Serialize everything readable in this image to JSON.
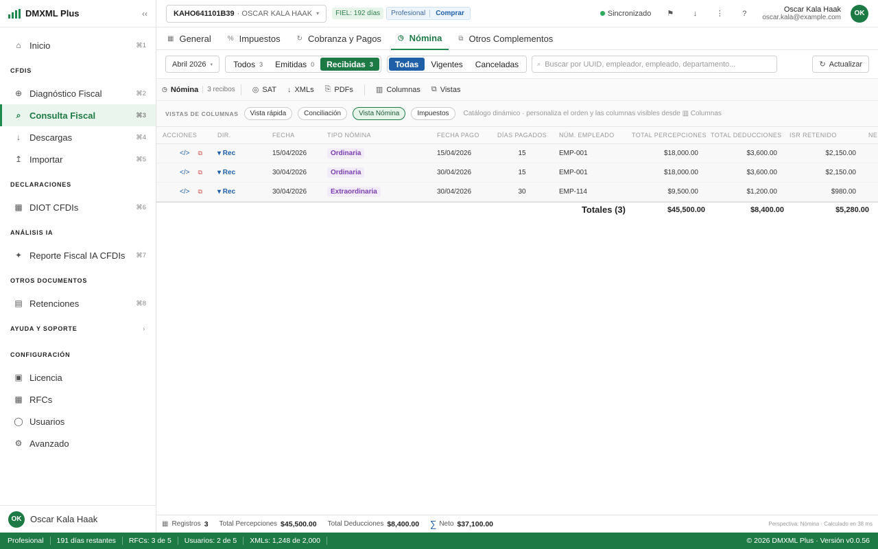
{
  "sidebar": {
    "brand": "DMXML Plus",
    "collapse_icon": "‹‹",
    "nav": [
      {
        "type": "item",
        "icon": "⌂",
        "icon_name": "home-icon",
        "label": "Inicio",
        "kbd": "⌘1"
      },
      {
        "type": "section",
        "label": "CFDIS"
      },
      {
        "type": "item",
        "icon": "⊕",
        "icon_name": "diagnostic-icon",
        "label": "Diagnóstico Fiscal",
        "kbd": "⌘2"
      },
      {
        "type": "item",
        "icon": "⌕",
        "icon_name": "search-icon",
        "label": "Consulta Fiscal",
        "kbd": "⌘3",
        "active": true
      },
      {
        "type": "item",
        "icon": "↓",
        "icon_name": "download-icon",
        "label": "Descargas",
        "kbd": "⌘4"
      },
      {
        "type": "item",
        "icon": "↥",
        "icon_name": "import-icon",
        "label": "Importar",
        "kbd": "⌘5"
      },
      {
        "type": "section",
        "label": "DECLARACIONES"
      },
      {
        "type": "item",
        "icon": "▦",
        "icon_name": "table-icon",
        "label": "DIOT CFDIs",
        "kbd": "⌘6"
      },
      {
        "type": "section",
        "label": "ANÁLISIS IA"
      },
      {
        "type": "item",
        "icon": "✦",
        "icon_name": "sparkle-icon",
        "label": "Reporte Fiscal IA CFDIs",
        "kbd": "⌘7"
      },
      {
        "type": "section",
        "label": "OTROS DOCUMENTOS"
      },
      {
        "type": "item",
        "icon": "▤",
        "icon_name": "document-icon",
        "label": "Retenciones",
        "kbd": "⌘8"
      },
      {
        "type": "section",
        "label": "AYUDA Y SOPORTE",
        "chevron": "›"
      },
      {
        "type": "section",
        "label": "CONFIGURACIÓN"
      },
      {
        "type": "item",
        "icon": "▣",
        "icon_name": "license-icon",
        "label": "Licencia",
        "kbd": ""
      },
      {
        "type": "item",
        "icon": "▦",
        "icon_name": "grid-icon",
        "label": "RFCs",
        "kbd": ""
      },
      {
        "type": "item",
        "icon": "◯",
        "icon_name": "user-icon",
        "label": "Usuarios",
        "kbd": ""
      },
      {
        "type": "item",
        "icon": "⚙",
        "icon_name": "gear-icon",
        "label": "Avanzado",
        "kbd": ""
      }
    ],
    "user": {
      "initials": "OK",
      "name": "Oscar Kala Haak"
    }
  },
  "topbar": {
    "rfc": "KAHO641101B39",
    "rfc_name": "· OSCAR KALA HAAK",
    "caret": "▾",
    "fiel": "FIEL: 192 días",
    "plan": "Profesional",
    "buy": "Comprar",
    "sync": "Sincronizado",
    "icons": [
      {
        "glyph": "⚑",
        "name": "flag-icon"
      },
      {
        "glyph": "↓",
        "name": "download-icon"
      },
      {
        "glyph": "⋮",
        "name": "more-icon"
      },
      {
        "glyph": "?",
        "name": "help-icon"
      }
    ],
    "user_name": "Oscar Kala Haak",
    "user_email": "oscar.kala@example.com",
    "initials": "OK"
  },
  "tabs": [
    {
      "icon": "▦",
      "icon_name": "general-icon",
      "label": "General"
    },
    {
      "icon": "%",
      "icon_name": "percent-icon",
      "label": "Impuestos"
    },
    {
      "icon": "↻",
      "icon_name": "payments-icon",
      "label": "Cobranza y Pagos"
    },
    {
      "icon": "◷",
      "icon_name": "payroll-icon",
      "label": "Nómina",
      "active": true
    },
    {
      "icon": "⧉",
      "icon_name": "complements-icon",
      "label": "Otros Complementos"
    }
  ],
  "filters": {
    "month": "Abril 2026",
    "direction": [
      {
        "label": "Todos",
        "count": "3"
      },
      {
        "label": "Emitidas",
        "count": "0"
      },
      {
        "label": "Recibidas",
        "count": "3",
        "active": true
      }
    ],
    "status": [
      {
        "label": "Todas",
        "active": true
      },
      {
        "label": "Vigentes"
      },
      {
        "label": "Canceladas"
      }
    ],
    "search_placeholder": "Buscar por UUID, empleador, empleado, departamento...",
    "refresh": "Actualizar"
  },
  "toolbar": {
    "title": "Nómina",
    "count": "3 recibos",
    "buttons": [
      {
        "icon": "◎",
        "icon_name": "sat-icon",
        "label": "SAT"
      },
      {
        "icon": "↓",
        "icon_name": "download-icon",
        "label": "XMLs"
      },
      {
        "icon": "⎘",
        "icon_name": "pdf-icon",
        "label": "PDFs"
      },
      {
        "icon": "▥",
        "icon_name": "columns-icon",
        "label": "Columnas"
      },
      {
        "icon": "⧉",
        "icon_name": "views-icon",
        "label": "Vistas"
      }
    ]
  },
  "views": {
    "label": "VISTAS DE COLUMNAS",
    "chips": [
      {
        "label": "Vista rápida"
      },
      {
        "label": "Conciliación"
      },
      {
        "label": "Vista Nómina",
        "active": true
      },
      {
        "label": "Impuestos"
      }
    ],
    "hint": "Catálogo dinámico · personaliza el orden y las columnas visibles desde ▥ Columnas"
  },
  "table": {
    "headers": [
      "ACCIONES",
      "DIR.",
      "FECHA",
      "TIPO NÓMINA",
      "FECHA PAGO",
      "DÍAS PAGADOS",
      "NÚM. EMPLEADO",
      "TOTAL PERCEPCIONES",
      "TOTAL DEDUCCIONES",
      "ISR RETENIDO",
      "NE"
    ],
    "rows": [
      {
        "dir": "▾ Rec",
        "fecha": "15/04/2026",
        "tipo": "Ordinaria",
        "fecha_pago": "15/04/2026",
        "dias": "15",
        "empleado": "EMP-001",
        "percepciones": "$18,000.00",
        "deducciones": "$3,600.00",
        "isr": "$2,150.00"
      },
      {
        "dir": "▾ Rec",
        "fecha": "30/04/2026",
        "tipo": "Ordinaria",
        "fecha_pago": "30/04/2026",
        "dias": "15",
        "empleado": "EMP-001",
        "percepciones": "$18,000.00",
        "deducciones": "$3,600.00",
        "isr": "$2,150.00"
      },
      {
        "dir": "▾ Rec",
        "fecha": "30/04/2026",
        "tipo": "Extraordinaria",
        "fecha_pago": "30/04/2026",
        "dias": "30",
        "empleado": "EMP-114",
        "percepciones": "$9,500.00",
        "deducciones": "$1,200.00",
        "isr": "$980.00"
      }
    ],
    "totals": {
      "label": "Totales (3)",
      "percepciones": "$45,500.00",
      "deducciones": "$8,400.00",
      "isr": "$5,280.00"
    }
  },
  "summary": {
    "registros_label": "Registros",
    "registros": "3",
    "perc_label": "Total Percepciones",
    "perc": "$45,500.00",
    "ded_label": "Total Deducciones",
    "ded": "$8,400.00",
    "neto_label": "Neto",
    "neto": "$37,100.00",
    "perf": "Perspectiva: Nómina · Calculado en 38 ms"
  },
  "statusbar": {
    "items": [
      "Profesional",
      "191 días restantes",
      "RFCs: 3 de 5",
      "Usuarios: 2 de 5",
      "XMLs: 1,248 de 2,000"
    ],
    "right": "© 2026 DMXML Plus · Versión v0.0.56"
  },
  "colors": {
    "brand_green": "#1e7a45",
    "link_blue": "#1e5fa8",
    "tag_purple": "#7b3fb0"
  }
}
